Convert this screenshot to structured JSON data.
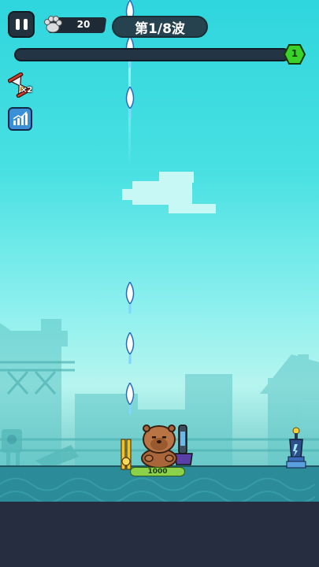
{
  "hud": {
    "coins": "20",
    "wave_label": "第1/8波",
    "wave_progress": 0.0,
    "level": "1",
    "speed_multiplier": "×2"
  },
  "player": {
    "hp": "1000"
  },
  "icons": {
    "pause": "pause-icon",
    "coin": "paw-coin-icon",
    "speed": "hourglass-icon",
    "stats": "bar-chart-icon"
  },
  "colors": {
    "sky": "#2fd6dd",
    "hud_dark": "#23323f",
    "level_badge": "#3ad12a",
    "hp_bar": "#8cd14a",
    "ground_dark": "#262d40"
  }
}
